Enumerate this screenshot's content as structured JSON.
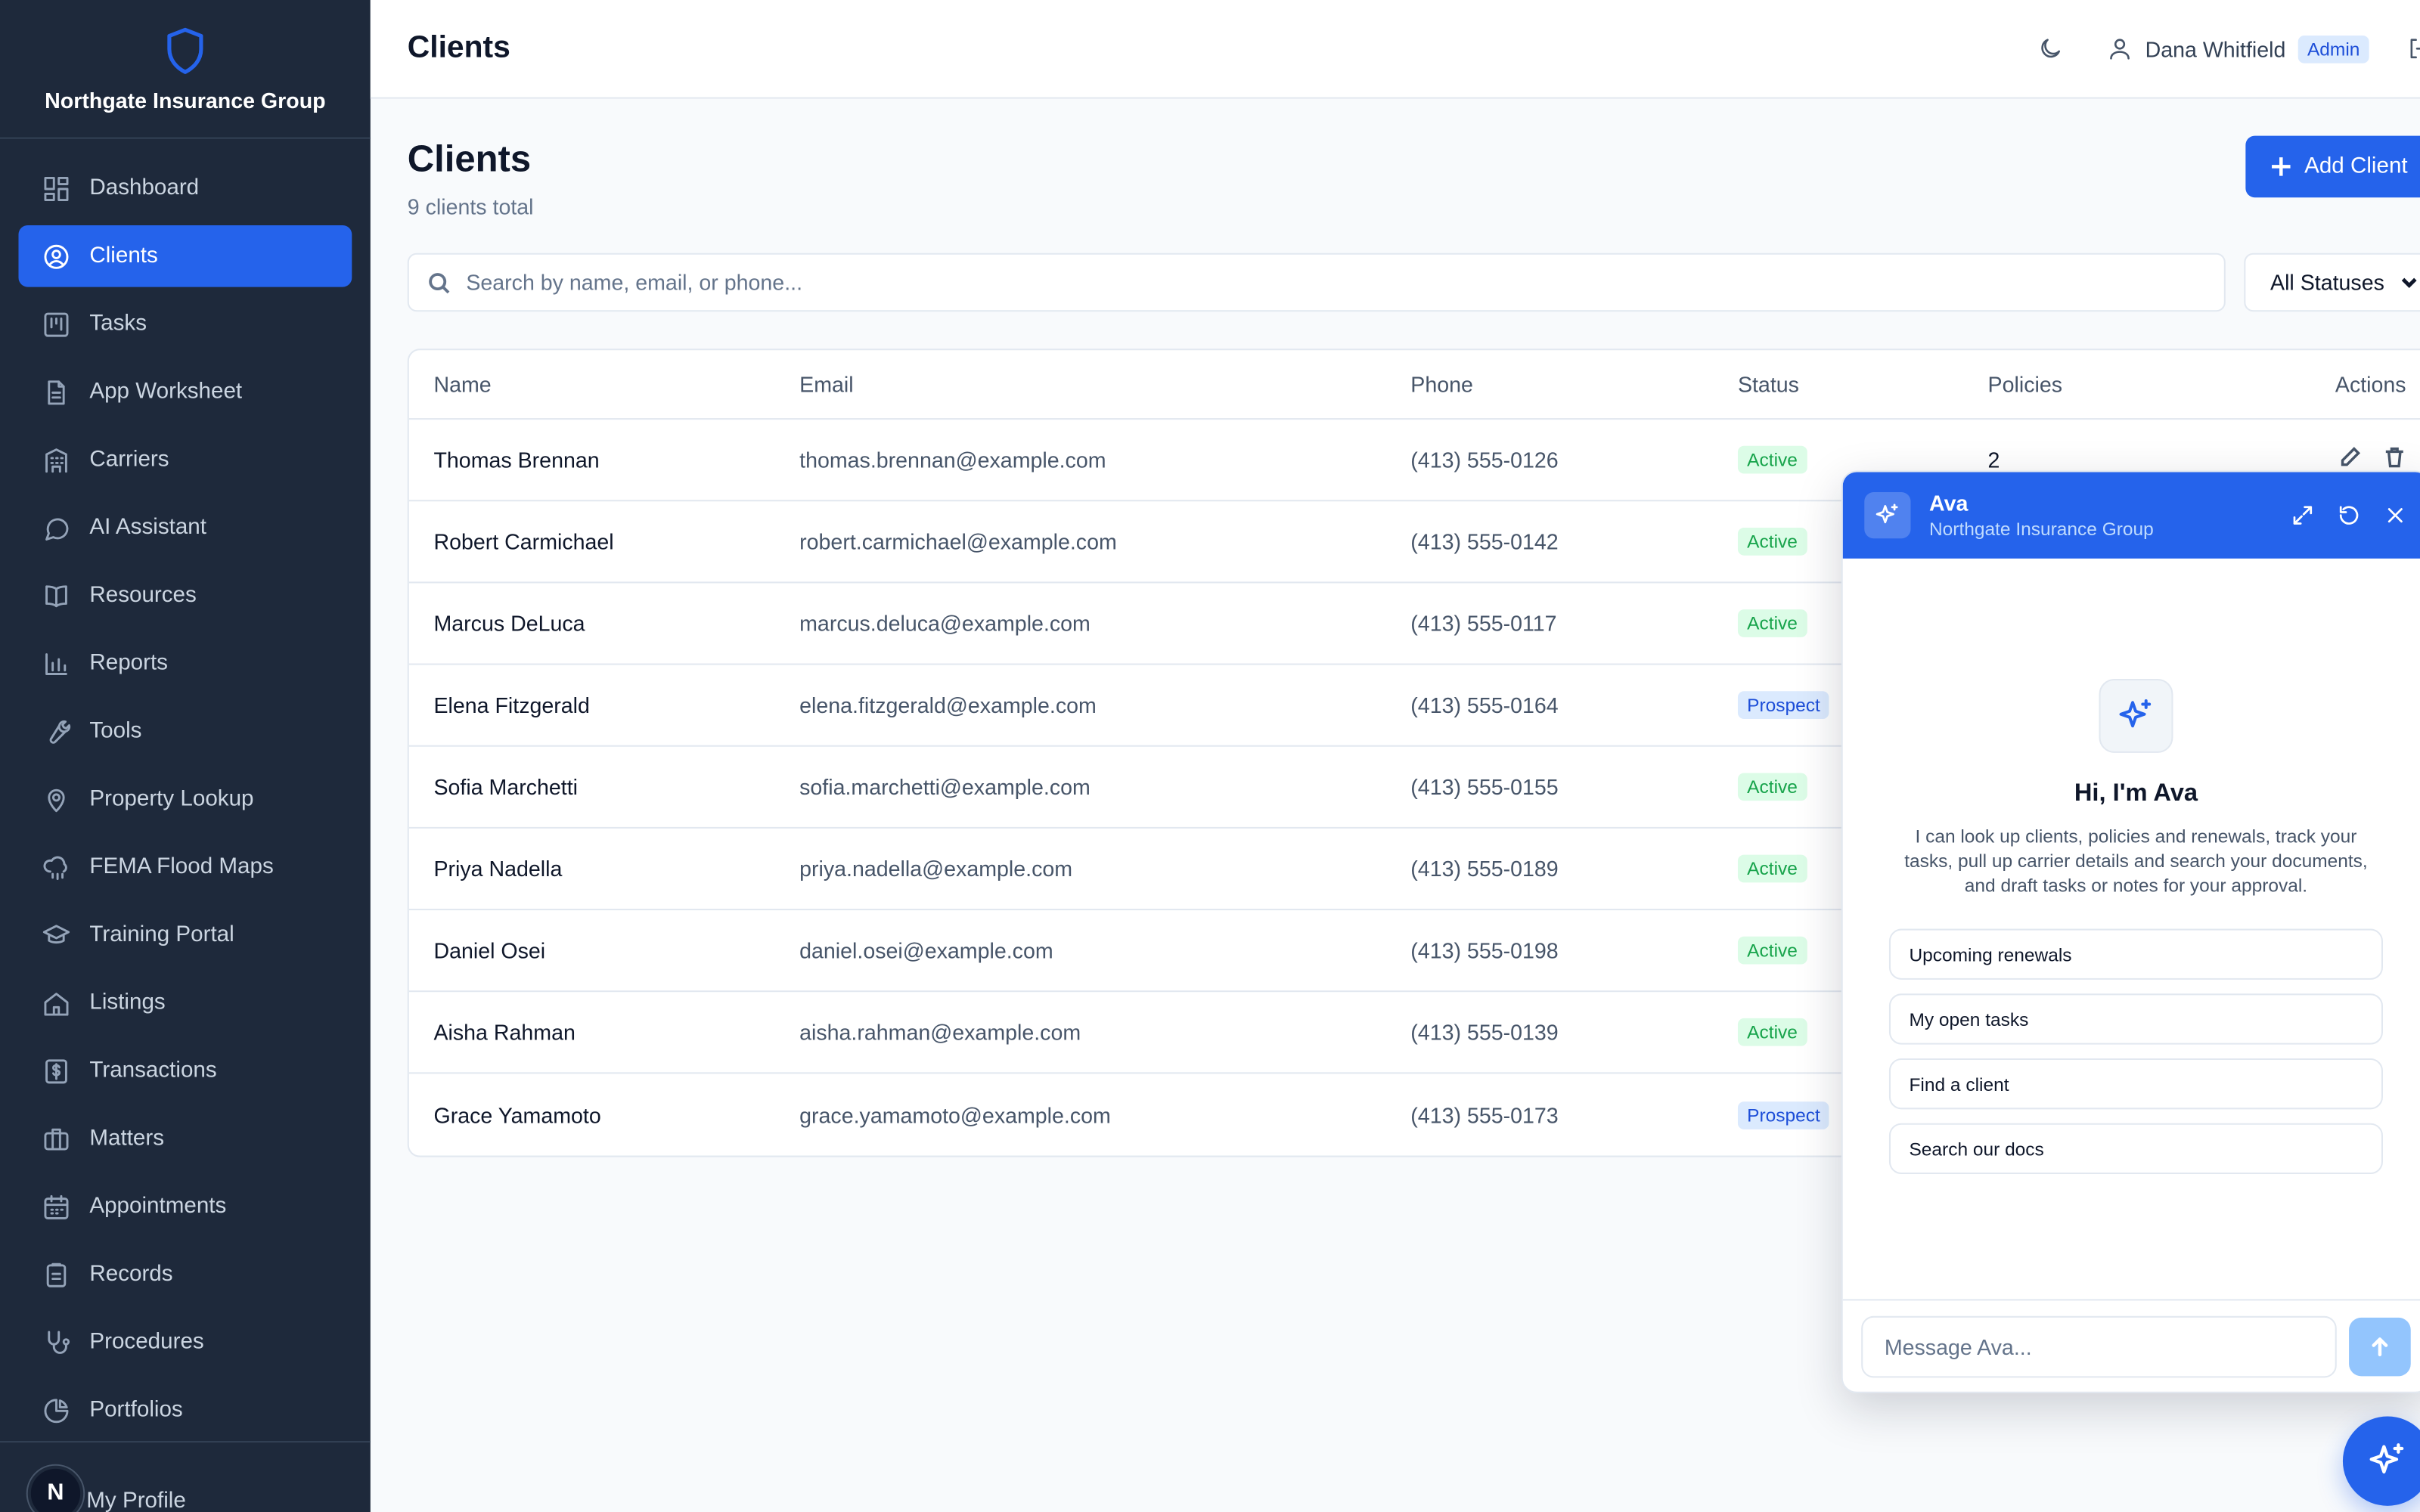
{
  "brand": {
    "name": "Northgate Insurance Group",
    "logo_icon": "shield-icon"
  },
  "sidebar": {
    "items": [
      {
        "label": "Dashboard",
        "icon": "dashboard-icon",
        "active": false
      },
      {
        "label": "Clients",
        "icon": "user-circle-icon",
        "active": true
      },
      {
        "label": "Tasks",
        "icon": "kanban-icon",
        "active": false
      },
      {
        "label": "App Worksheet",
        "icon": "document-icon",
        "active": false
      },
      {
        "label": "Carriers",
        "icon": "building-icon",
        "active": false
      },
      {
        "label": "AI Assistant",
        "icon": "chat-bubble-icon",
        "active": false
      },
      {
        "label": "Resources",
        "icon": "book-icon",
        "active": false
      },
      {
        "label": "Reports",
        "icon": "bar-chart-icon",
        "active": false
      },
      {
        "label": "Tools",
        "icon": "wrench-icon",
        "active": false
      },
      {
        "label": "Property Lookup",
        "icon": "map-pin-icon",
        "active": false
      },
      {
        "label": "FEMA Flood Maps",
        "icon": "cloud-rain-icon",
        "active": false
      },
      {
        "label": "Training Portal",
        "icon": "graduation-cap-icon",
        "active": false
      },
      {
        "label": "Listings",
        "icon": "home-icon",
        "active": false
      },
      {
        "label": "Transactions",
        "icon": "dollar-receipt-icon",
        "active": false
      },
      {
        "label": "Matters",
        "icon": "briefcase-icon",
        "active": false
      },
      {
        "label": "Appointments",
        "icon": "calendar-icon",
        "active": false
      },
      {
        "label": "Records",
        "icon": "clipboard-icon",
        "active": false
      },
      {
        "label": "Procedures",
        "icon": "stethoscope-icon",
        "active": false
      },
      {
        "label": "Portfolios",
        "icon": "pie-chart-icon",
        "active": false
      }
    ],
    "profile": {
      "avatar_letter": "N",
      "label": "My Profile"
    }
  },
  "header": {
    "title": "Clients",
    "user_name": "Dana Whitfield",
    "role": "Admin"
  },
  "main": {
    "title": "Clients",
    "subtitle": "9 clients total",
    "add_label": "Add Client",
    "search_placeholder": "Search by name, email, or phone...",
    "status_filter": "All Statuses",
    "columns": [
      "Name",
      "Email",
      "Phone",
      "Status",
      "Policies",
      "Actions"
    ],
    "rows": [
      {
        "name": "Thomas Brennan",
        "email": "thomas.brennan@example.com",
        "phone": "(413) 555-0126",
        "status": "Active",
        "policies": "2"
      },
      {
        "name": "Robert Carmichael",
        "email": "robert.carmichael@example.com",
        "phone": "(413) 555-0142",
        "status": "Active",
        "policies": ""
      },
      {
        "name": "Marcus DeLuca",
        "email": "marcus.deluca@example.com",
        "phone": "(413) 555-0117",
        "status": "Active",
        "policies": ""
      },
      {
        "name": "Elena Fitzgerald",
        "email": "elena.fitzgerald@example.com",
        "phone": "(413) 555-0164",
        "status": "Prospect",
        "policies": ""
      },
      {
        "name": "Sofia Marchetti",
        "email": "sofia.marchetti@example.com",
        "phone": "(413) 555-0155",
        "status": "Active",
        "policies": ""
      },
      {
        "name": "Priya Nadella",
        "email": "priya.nadella@example.com",
        "phone": "(413) 555-0189",
        "status": "Active",
        "policies": ""
      },
      {
        "name": "Daniel Osei",
        "email": "daniel.osei@example.com",
        "phone": "(413) 555-0198",
        "status": "Active",
        "policies": ""
      },
      {
        "name": "Aisha Rahman",
        "email": "aisha.rahman@example.com",
        "phone": "(413) 555-0139",
        "status": "Active",
        "policies": ""
      },
      {
        "name": "Grace Yamamoto",
        "email": "grace.yamamoto@example.com",
        "phone": "(413) 555-0173",
        "status": "Prospect",
        "policies": ""
      }
    ]
  },
  "chat": {
    "name": "Ava",
    "org": "Northgate Insurance Group",
    "greeting": "Hi, I'm Ava",
    "intro": "I can look up clients, policies and renewals, track your tasks, pull up carrier details and search your documents, and draft tasks or notes for your approval.",
    "suggestions": [
      "Upcoming renewals",
      "My open tasks",
      "Find a client",
      "Search our docs"
    ],
    "input_placeholder": "Message Ava..."
  },
  "colors": {
    "sidebar_bg": "#1e293b",
    "accent": "#2563eb",
    "active_badge": "#16a34a",
    "prospect_badge": "#1d4ed8"
  }
}
